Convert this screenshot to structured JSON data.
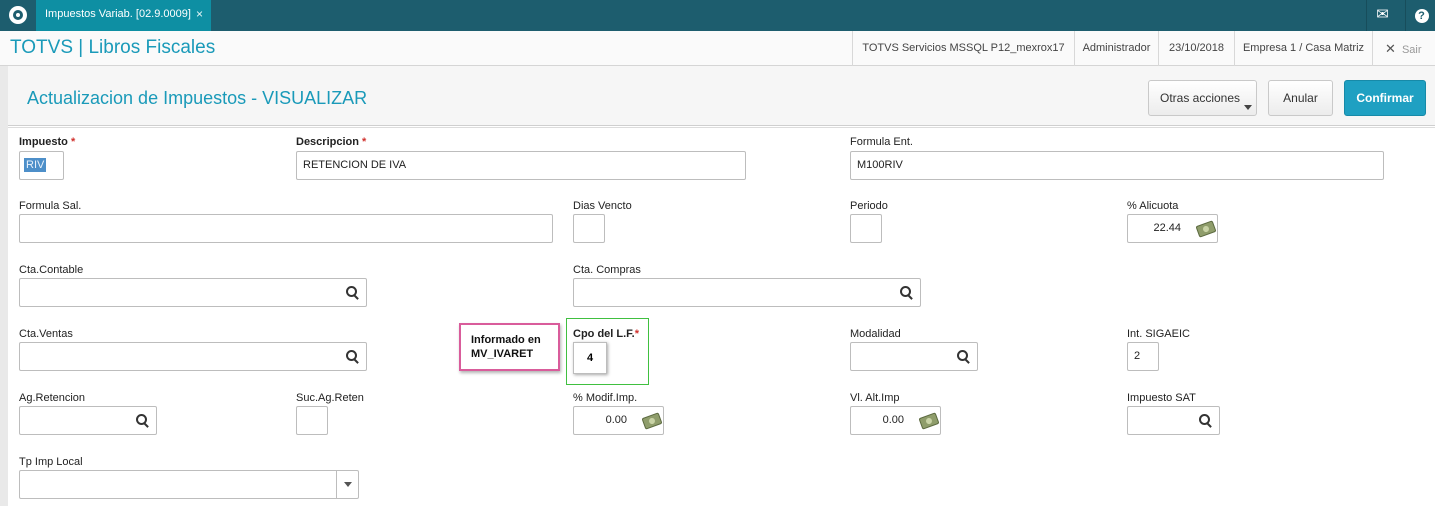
{
  "topbar": {
    "tab_label": "Impuestos Variab. [02.9.0009]",
    "tab_close": "×",
    "mail_icon": "mail-icon",
    "help_icon": "help-icon",
    "help_glyph": "?"
  },
  "appbar": {
    "title": "TOTVS | Libros Fiscales",
    "server": "TOTVS Servicios MSSQL P12_mexrox17",
    "user": "Administrador",
    "date": "23/10/2018",
    "company": "Empresa 1 / Casa Matriz",
    "exit_label": "Sair",
    "exit_glyph": "✕"
  },
  "header": {
    "form_title": "Actualizacion de Impuestos - VISUALIZAR",
    "otras_acciones": "Otras acciones",
    "anular": "Anular",
    "confirmar": "Confirmar"
  },
  "fields": {
    "impuesto": {
      "label": "Impuesto",
      "value": "RIV",
      "required": "*"
    },
    "descripcion": {
      "label": "Descripcion",
      "value": "RETENCION DE IVA",
      "required": "*"
    },
    "formula_ent": {
      "label": "Formula Ent.",
      "value": "M100RIV"
    },
    "formula_sal": {
      "label": "Formula Sal.",
      "value": ""
    },
    "dias_vencto": {
      "label": "Dias Vencto",
      "value": ""
    },
    "periodo": {
      "label": "Periodo",
      "value": ""
    },
    "alicuota": {
      "label": "% Alicuota",
      "value": "22.44"
    },
    "cta_contable": {
      "label": "Cta.Contable",
      "value": ""
    },
    "cta_compras": {
      "label": "Cta. Compras",
      "value": ""
    },
    "cta_ventas": {
      "label": "Cta.Ventas",
      "value": ""
    },
    "cpo_lf": {
      "label": "Cpo del L.F.",
      "value": "4",
      "required": "*"
    },
    "modalidad": {
      "label": "Modalidad",
      "value": ""
    },
    "int_sigaeic": {
      "label": "Int. SIGAEIC",
      "value": "2"
    },
    "ag_retencion": {
      "label": "Ag.Retencion",
      "value": ""
    },
    "suc_ag_reten": {
      "label": "Suc.Ag.Reten",
      "value": ""
    },
    "modif_imp": {
      "label": "% Modif.Imp.",
      "value": "0.00"
    },
    "vl_alt_imp": {
      "label": "Vl. Alt.Imp",
      "value": "0.00"
    },
    "impuesto_sat": {
      "label": "Impuesto SAT",
      "value": ""
    },
    "tp_imp_local": {
      "label": "Tp Imp Local",
      "value": ""
    }
  },
  "annotation": {
    "line1": "Informado en",
    "line2": "MV_IVARET"
  },
  "colors": {
    "topbar": "#1d5d6e",
    "tab": "#0e8fa3",
    "title_accent": "#1a9ab9",
    "confirm_button": "#1fa0c2",
    "required": "#d0312d",
    "annotation_border": "#d95c9b",
    "highlight_border": "#40c040"
  }
}
